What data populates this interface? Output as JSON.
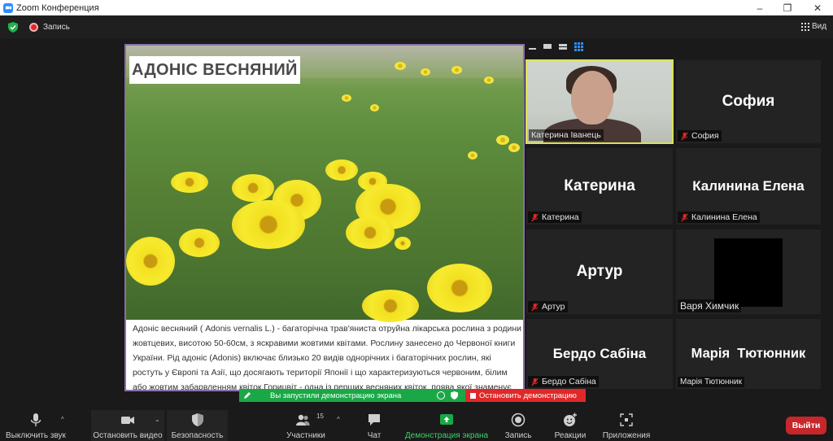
{
  "window": {
    "title": "Zoom Конференция",
    "controls": [
      "minimize-icon",
      "maximize-icon",
      "close-icon"
    ]
  },
  "topbar": {
    "recording_label": "Запись",
    "view_label": "Вид"
  },
  "share": {
    "slide_title": "АДОНІС ВЕСНЯНИЙ",
    "description": "Адоніс весняний ( Adonis vernalis L.) - багаторічна трав'яниста отруйна лікарська рослина з родини жовтцевих, висотою 50-60см, з яскравими жовтими квітами. Рослину занесено до Червоної книги України. Рід адоніс (Adonis) включає близько 20 видів однорічних і багаторічних рослин, які ростуть у Європі та Азії, що досягають території Японії і що характеризуються червоним, білим або жовтим забарвленням квіток.Горицвіт - одна із перших весняних квіток, поява якої знаменує пробудження природи."
  },
  "participants": [
    {
      "name": "Катерина Іванець",
      "display": "",
      "muted": false,
      "active": true,
      "video": true
    },
    {
      "name": "София",
      "display": "София",
      "muted": true
    },
    {
      "name": "Катерина",
      "display": "Катерина",
      "muted": true
    },
    {
      "name": "Калинина Елена",
      "display": "Калинина Елена",
      "muted": true
    },
    {
      "name": "Артур",
      "display": "Артур",
      "muted": true
    },
    {
      "name": "Варя Химчик",
      "display": "",
      "muted": false,
      "black": true
    },
    {
      "name": "Бердо Сабіна",
      "display": "Бердо Сабіна",
      "muted": true
    },
    {
      "name": "Марія Тютюнник",
      "display": "Марія  Тютюнник",
      "muted": false
    }
  ],
  "notification": {
    "sharing_text": "Вы запустили демонстрацию экрана",
    "stop_label": "Остановить демонстрацию"
  },
  "toolbar": {
    "mute_label": "Выключить звук",
    "video_label": "Остановить видео",
    "security_label": "Безопасность",
    "participants_label": "Участники",
    "participants_count": "15",
    "chat_label": "Чат",
    "share_label": "Демонстрация экрана",
    "record_label": "Запись",
    "reactions_label": "Реакции",
    "apps_label": "Приложения",
    "leave_label": "Выйти"
  },
  "colors": {
    "accent_green": "#39d46b",
    "stop_red": "#e02828",
    "leave_red": "#c7262b",
    "active_speaker": "#d9e35a"
  }
}
